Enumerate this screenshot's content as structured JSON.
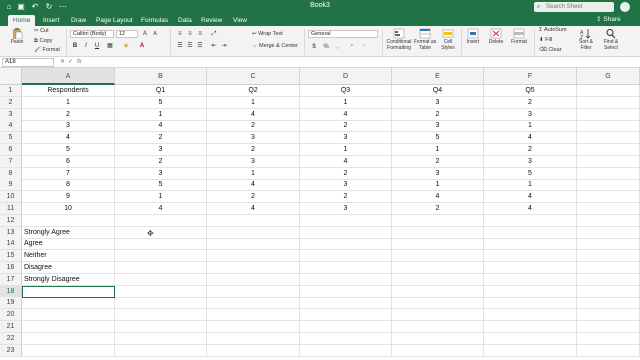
{
  "window": {
    "title": "Book3",
    "search_placeholder": "Search Sheet"
  },
  "tabs": [
    "Home",
    "Insert",
    "Draw",
    "Page Layout",
    "Formulas",
    "Data",
    "Review",
    "View"
  ],
  "share_label": "Share",
  "ribbon": {
    "paste": "Paste",
    "cut": "Cut",
    "copy": "Copy",
    "format": "Format",
    "font_name": "Calibri (Body)",
    "font_size": "12",
    "wrap_text": "Wrap Text",
    "merge_center": "Merge & Center",
    "number_format": "General",
    "conditional_formatting": "Conditional Formatting",
    "format_as_table": "Format as Table",
    "cell_styles": "Cell Styles",
    "insert": "Insert",
    "delete": "Delete",
    "format_btn": "Format",
    "autosum": "AutoSum",
    "fill": "Fill",
    "clear": "Clear",
    "sort_filter": "Sort & Filter",
    "find_select": "Find & Select"
  },
  "formula_bar": {
    "name_box": "A18",
    "fx": "fx"
  },
  "columns": [
    "A",
    "B",
    "C",
    "D",
    "E",
    "F",
    "G"
  ],
  "rows": [
    [
      "Respondents",
      "Q1",
      "Q2",
      "Q3",
      "Q4",
      "Q5",
      ""
    ],
    [
      "1",
      "5",
      "1",
      "1",
      "3",
      "2",
      ""
    ],
    [
      "2",
      "1",
      "4",
      "4",
      "2",
      "3",
      ""
    ],
    [
      "3",
      "4",
      "2",
      "2",
      "3",
      "1",
      ""
    ],
    [
      "4",
      "2",
      "3",
      "3",
      "5",
      "4",
      ""
    ],
    [
      "5",
      "3",
      "2",
      "1",
      "1",
      "2",
      ""
    ],
    [
      "6",
      "2",
      "3",
      "4",
      "2",
      "3",
      ""
    ],
    [
      "7",
      "3",
      "1",
      "2",
      "3",
      "5",
      ""
    ],
    [
      "8",
      "5",
      "4",
      "3",
      "1",
      "1",
      ""
    ],
    [
      "9",
      "1",
      "2",
      "2",
      "4",
      "4",
      ""
    ],
    [
      "10",
      "4",
      "4",
      "3",
      "2",
      "4",
      ""
    ],
    [
      "",
      "",
      "",
      "",
      "",
      "",
      ""
    ],
    [
      "Strongly Agree",
      "",
      "",
      "",
      "",
      "",
      ""
    ],
    [
      "Agree",
      "",
      "",
      "",
      "",
      "",
      ""
    ],
    [
      "Neither",
      "",
      "",
      "",
      "",
      "",
      ""
    ],
    [
      "Disagree",
      "",
      "",
      "",
      "",
      "",
      ""
    ],
    [
      "Strongly Disagree",
      "",
      "",
      "",
      "",
      "",
      ""
    ],
    [
      "",
      "",
      "",
      "",
      "",
      "",
      ""
    ],
    [
      "",
      "",
      "",
      "",
      "",
      "",
      ""
    ],
    [
      "",
      "",
      "",
      "",
      "",
      "",
      ""
    ],
    [
      "",
      "",
      "",
      "",
      "",
      "",
      ""
    ],
    [
      "",
      "",
      "",
      "",
      "",
      "",
      ""
    ],
    [
      "",
      "",
      "",
      "",
      "",
      "",
      ""
    ]
  ],
  "selected_cell": "A18",
  "colors": {
    "accent": "#217346"
  }
}
